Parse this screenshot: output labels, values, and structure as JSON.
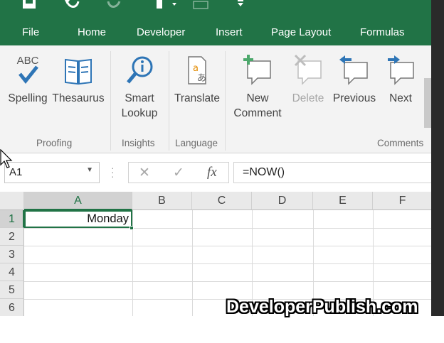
{
  "ribbon_tabs": [
    "File",
    "Home",
    "Developer",
    "Insert",
    "Page Layout",
    "Formulas"
  ],
  "quick_access": [
    "save-icon",
    "undo-icon",
    "redo-icon",
    "touch-mode-icon",
    "customize-icon"
  ],
  "ribbon": {
    "proofing": {
      "label": "Proofing",
      "spelling": "Spelling",
      "thesaurus": "Thesaurus",
      "spelling_icon_text": "ABC"
    },
    "insights": {
      "label": "Insights",
      "smart_lookup_line1": "Smart",
      "smart_lookup_line2": "Lookup"
    },
    "language": {
      "label": "Language",
      "translate": "Translate"
    },
    "comments": {
      "label": "Comments",
      "new_comment_line1": "New",
      "new_comment_line2": "Comment",
      "delete": "Delete",
      "previous": "Previous",
      "next": "Next"
    }
  },
  "formula_bar": {
    "name_box": "A1",
    "formula": "=NOW()",
    "fx_label": "fx"
  },
  "columns": [
    "A",
    "B",
    "C",
    "D",
    "E",
    "F"
  ],
  "rows": [
    "1",
    "2",
    "3",
    "4",
    "5",
    "6"
  ],
  "cells": {
    "A1": "Monday"
  },
  "watermark": "DeveloperPublish.com",
  "colors": {
    "accent": "#217346",
    "ribbon_bg": "#f3f3f3",
    "icon_blue": "#2e75b6",
    "icon_green": "#4ca86b"
  }
}
